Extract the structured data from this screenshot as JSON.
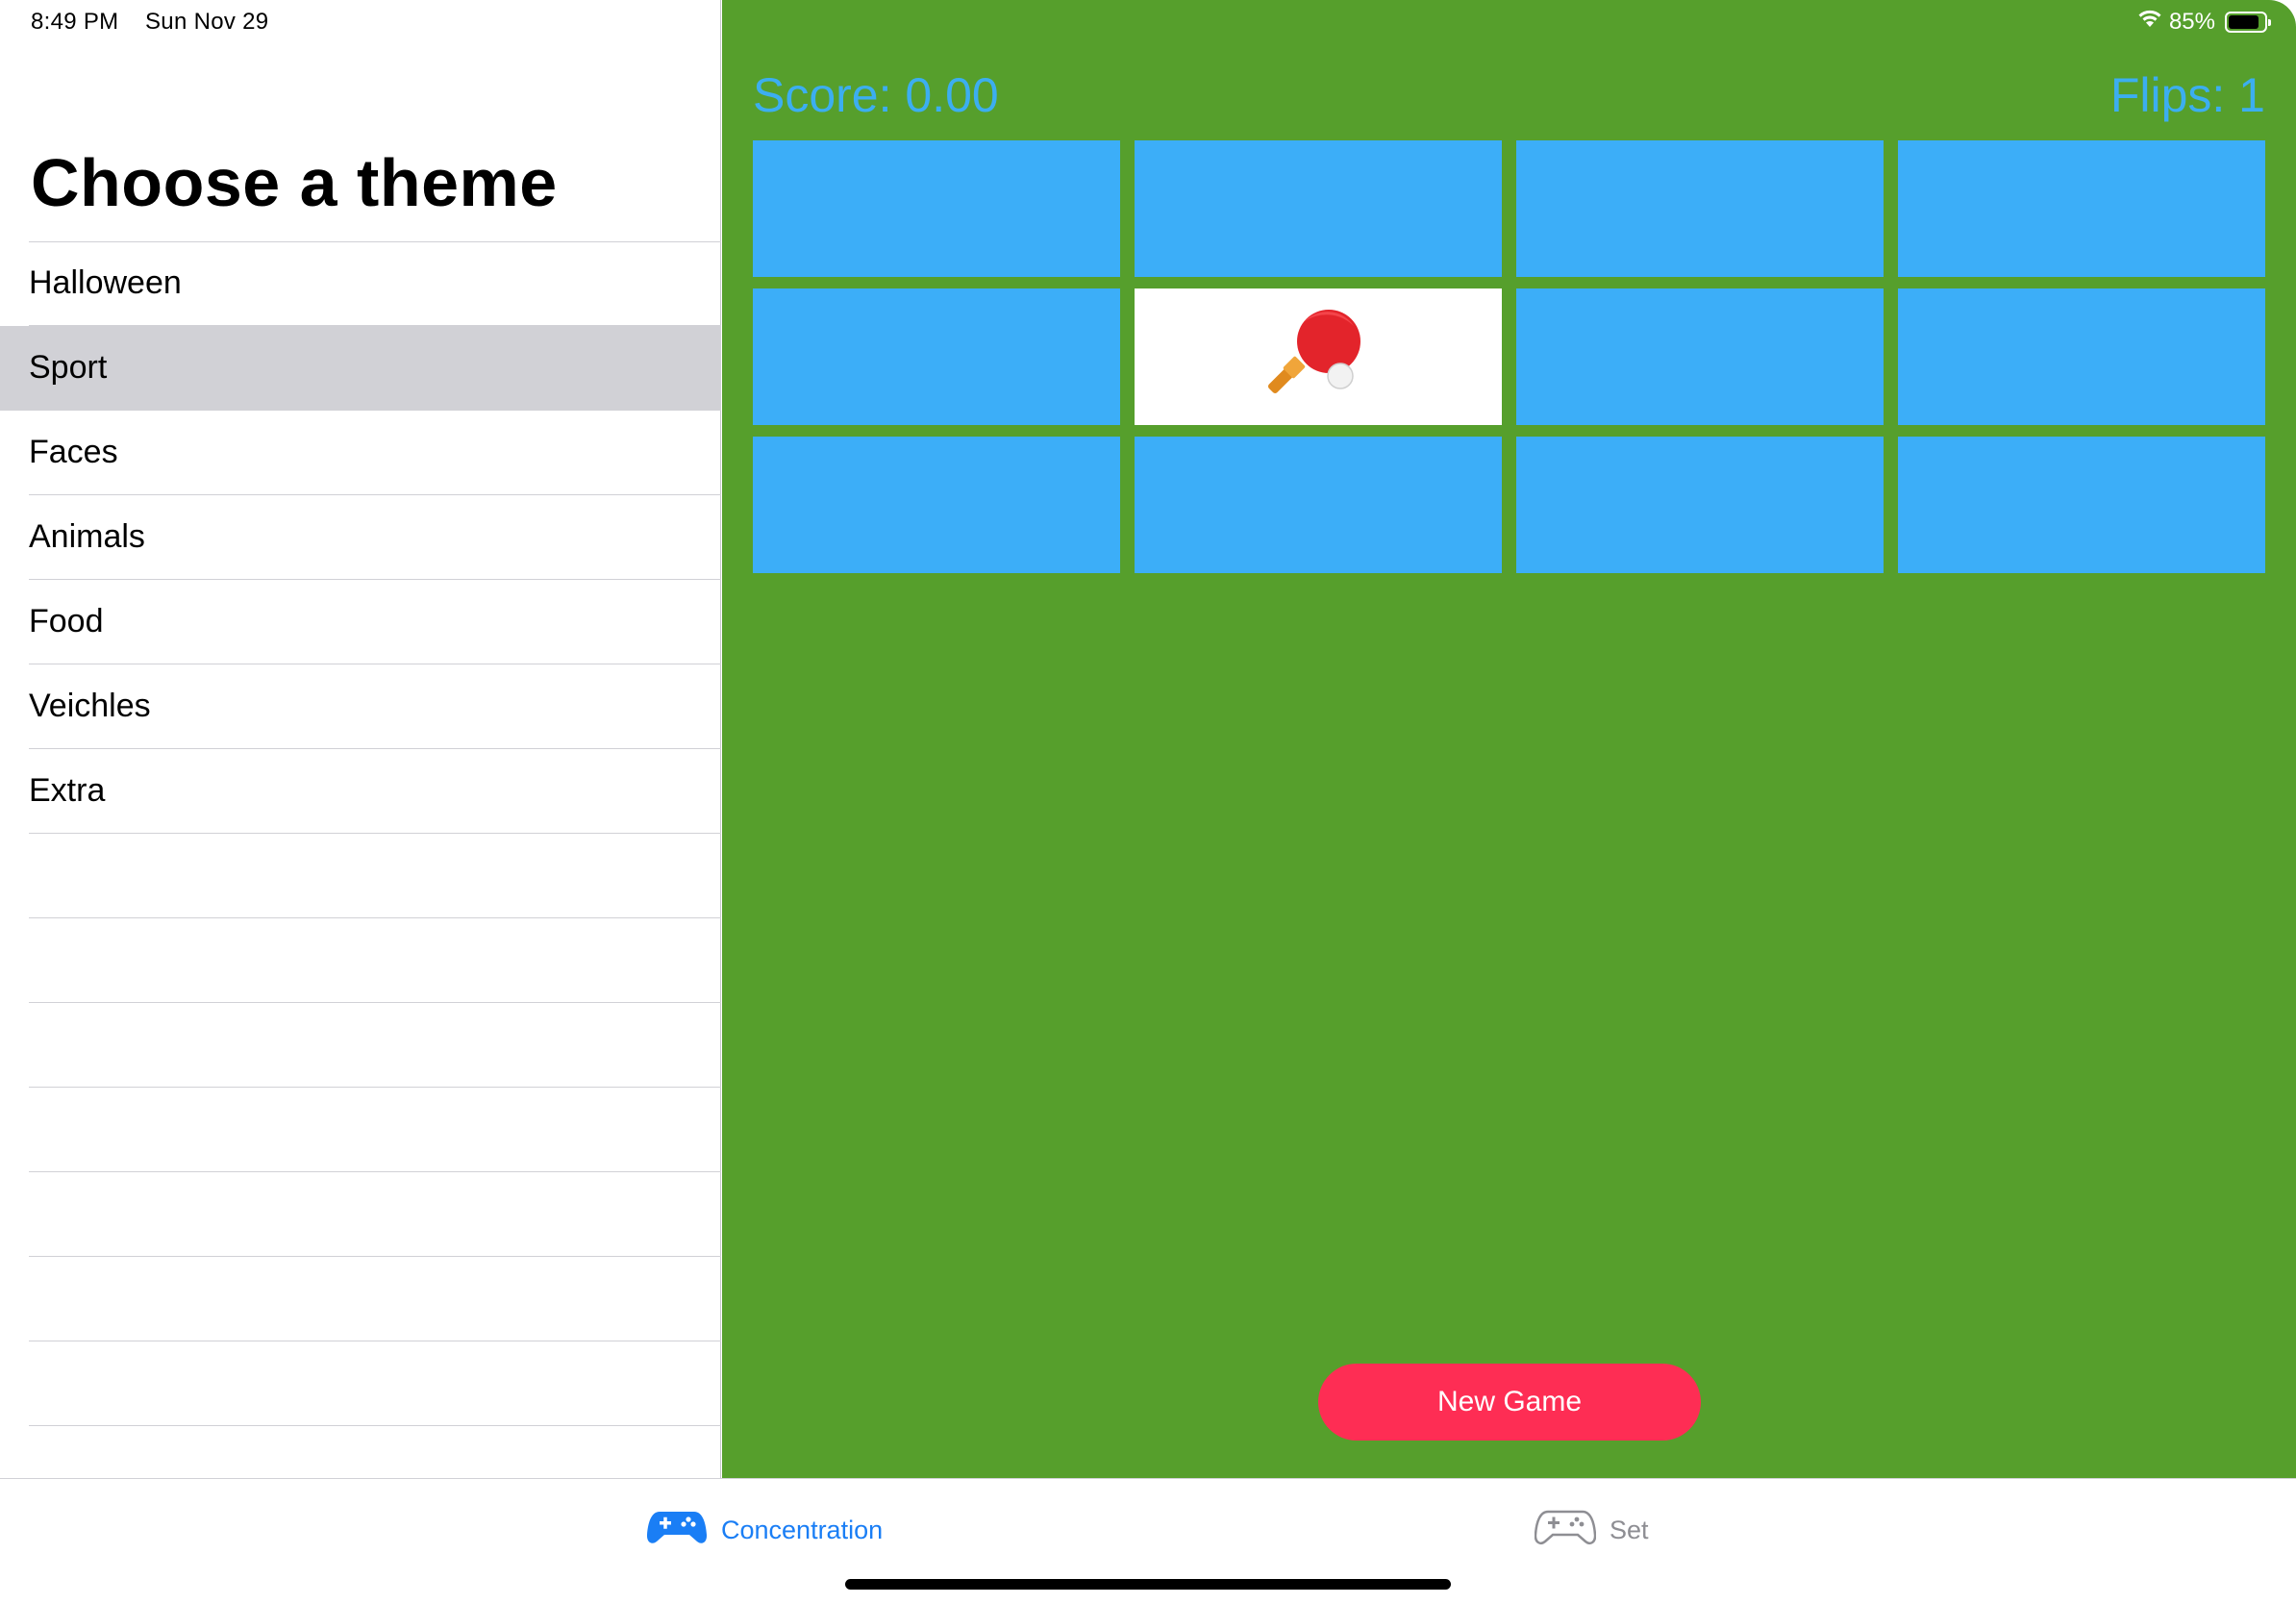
{
  "status_bar": {
    "time": "8:49 PM",
    "date": "Sun Nov 29",
    "battery_percent": "85%",
    "battery_level": 0.85,
    "wifi_icon": "wifi-icon"
  },
  "sidebar": {
    "title": "Choose a theme",
    "themes": [
      {
        "label": "Halloween",
        "selected": false
      },
      {
        "label": "Sport",
        "selected": true
      },
      {
        "label": "Faces",
        "selected": false
      },
      {
        "label": "Animals",
        "selected": false
      },
      {
        "label": "Food",
        "selected": false
      },
      {
        "label": "Veichles",
        "selected": false
      },
      {
        "label": "Extra",
        "selected": false
      }
    ],
    "empty_rows": 8
  },
  "game": {
    "score": "Score: 0.00",
    "flips": "Flips: 1",
    "background_color": "#569f2c",
    "card_back_color": "#3caef8",
    "cards": [
      {
        "face_up": false,
        "emoji": ""
      },
      {
        "face_up": false,
        "emoji": ""
      },
      {
        "face_up": false,
        "emoji": ""
      },
      {
        "face_up": false,
        "emoji": ""
      },
      {
        "face_up": false,
        "emoji": ""
      },
      {
        "face_up": true,
        "emoji": "ping-pong-icon"
      },
      {
        "face_up": false,
        "emoji": ""
      },
      {
        "face_up": false,
        "emoji": ""
      },
      {
        "face_up": false,
        "emoji": ""
      },
      {
        "face_up": false,
        "emoji": ""
      },
      {
        "face_up": false,
        "emoji": ""
      },
      {
        "face_up": false,
        "emoji": ""
      }
    ],
    "new_game_label": "New Game",
    "new_game_color": "#fe2d54"
  },
  "tabbar": {
    "tabs": [
      {
        "label": "Concentration",
        "icon": "game-controller-icon",
        "active": true
      },
      {
        "label": "Set",
        "icon": "game-controller-outline-icon",
        "active": false
      }
    ],
    "active_color": "#1a7ef5"
  }
}
